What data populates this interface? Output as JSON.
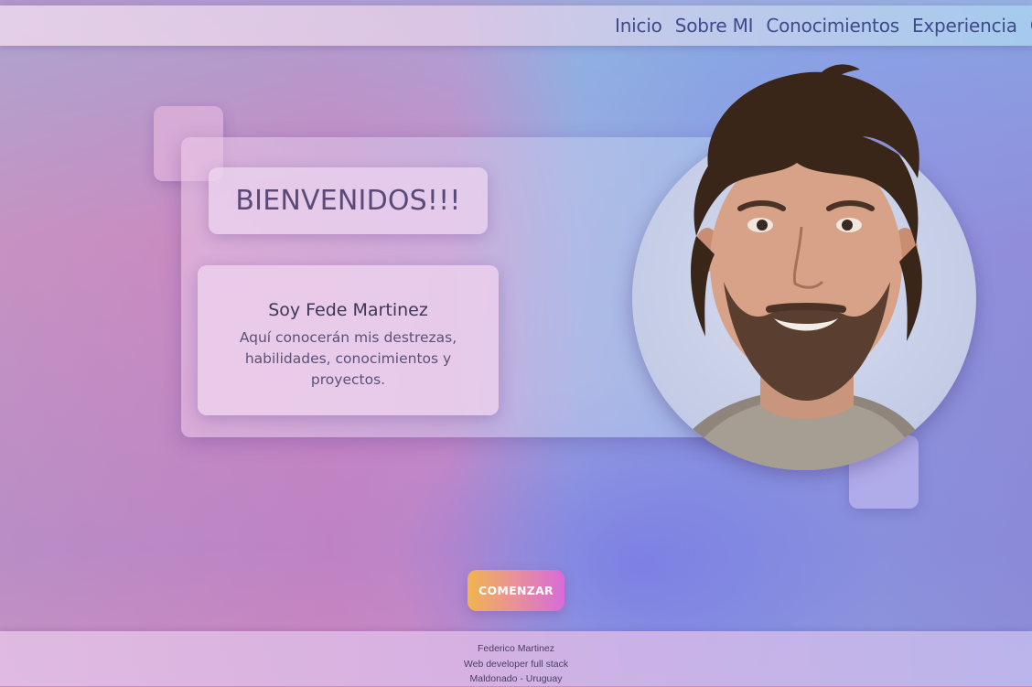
{
  "nav": {
    "links": [
      "Inicio",
      "Sobre MI",
      "Conocimientos",
      "Experiencia",
      "C"
    ]
  },
  "hero": {
    "welcome_title": "BIENVENIDOS!!!",
    "name": "Soy Fede Martinez",
    "description": "Aquí conocerán mis destrezas, habilidades, conocimientos y proyectos."
  },
  "cta": {
    "label": "COMENZAR"
  },
  "footer": {
    "lines": [
      "Federico Martinez",
      "Web developer full stack",
      "Maldonado - Uruguay"
    ]
  },
  "colors": {
    "nav_text": "#3e4a8a",
    "button_gradient_start": "#f0b54e",
    "button_gradient_end": "#d76bd9"
  }
}
